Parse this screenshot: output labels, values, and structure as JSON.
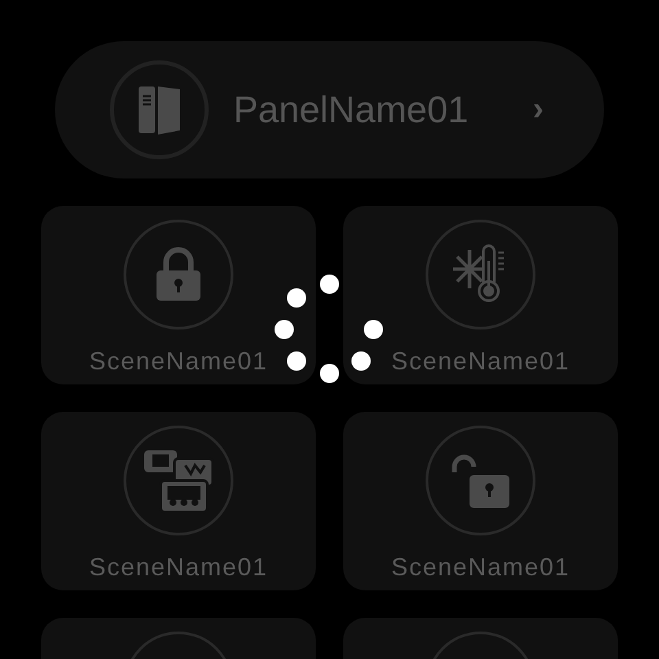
{
  "panel": {
    "name": "PanelName01",
    "chevron": "›"
  },
  "loading": true,
  "scenes": [
    {
      "kind": "lock",
      "name": "SceneName01"
    },
    {
      "kind": "climate",
      "name": "SceneName01"
    },
    {
      "kind": "media",
      "name": "SceneName01"
    },
    {
      "kind": "unlock",
      "name": "SceneName01"
    },
    {
      "kind": "hidden"
    },
    {
      "kind": "hidden"
    }
  ]
}
